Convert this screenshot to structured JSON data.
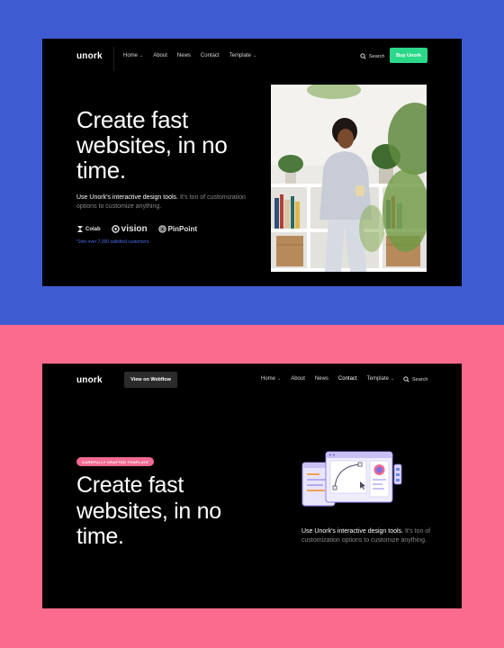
{
  "colors": {
    "top_bg": "#3f5bd2",
    "bottom_bg": "#fb6b8d",
    "buy_button": "#2bd88a",
    "badge": "#f16a92",
    "join_link": "#4f6df0"
  },
  "top": {
    "logo": "unork",
    "nav": [
      {
        "label": "Home",
        "has_caret": true
      },
      {
        "label": "About",
        "has_caret": false
      },
      {
        "label": "News",
        "has_caret": false
      },
      {
        "label": "Contact",
        "has_caret": false
      },
      {
        "label": "Template",
        "has_caret": true
      }
    ],
    "search_label": "Search",
    "buy_label": "Buy Unork",
    "headline": "Create fast websites, in no time.",
    "desc_highlight": "Use Unork's interactive design tools.",
    "desc_rest": " It's ton of customization options to customize anything.",
    "brands": [
      "Colab",
      "vision",
      "PinPoint"
    ],
    "join_text": "*Join over 7,000 satisfied customers."
  },
  "bottom": {
    "logo": "unork",
    "view_label": "View on Webflow",
    "nav": [
      {
        "label": "Home",
        "has_caret": true
      },
      {
        "label": "About",
        "has_caret": false
      },
      {
        "label": "News",
        "has_caret": false
      },
      {
        "label": "Contact",
        "has_caret": false
      },
      {
        "label": "Template",
        "has_caret": true
      }
    ],
    "search_label": "Search",
    "badge": "CAREFULLY CRAFTED TEMPLATE",
    "headline": "Create fast websites, in no time.",
    "desc_highlight": "Use Unork's interactive design tools.",
    "desc_rest": " It's ton of customization options to customize anything."
  }
}
